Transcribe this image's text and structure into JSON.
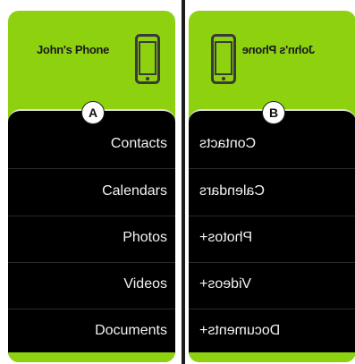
{
  "panels": [
    {
      "badge": "A",
      "device_name": "John's Phone",
      "items": [
        "Contacts",
        "Calendars",
        "Photos",
        "Videos",
        "Documents"
      ]
    },
    {
      "badge": "B",
      "device_name": "John's Phone",
      "items": [
        "Contacts",
        "Calendars",
        "Photos+",
        "Videos+",
        "Documents+"
      ]
    }
  ],
  "colors": {
    "accent_green": "#8dd10f",
    "list_background": "#000000",
    "divider": "#1d1d1d"
  },
  "icons": [
    "phone-icon"
  ]
}
